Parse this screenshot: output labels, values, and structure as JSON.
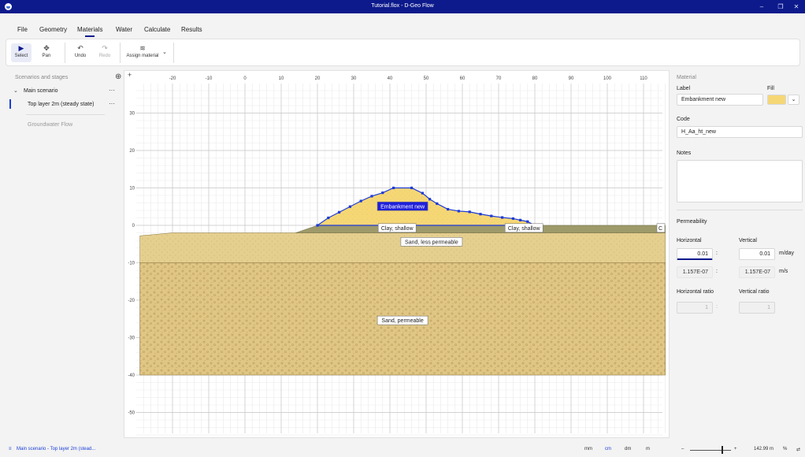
{
  "window": {
    "title": "Tutorial.flox - D-Geo Flow"
  },
  "menu": {
    "items": [
      "File",
      "Geometry",
      "Materials",
      "Water",
      "Calculate",
      "Results"
    ],
    "active": "Materials"
  },
  "toolbar": {
    "select": "Select",
    "pan": "Pan",
    "undo": "Undo",
    "redo": "Redo",
    "assign_material": "Assign material"
  },
  "left_panel": {
    "header": "Scenarios and stages",
    "scenario": "Main scenario",
    "stage": "Top layer 2m (steady state)",
    "section": "Groundwater Flow",
    "more": "···"
  },
  "canvas": {
    "x_ticks": [
      -20,
      -10,
      0,
      10,
      20,
      30,
      40,
      50,
      60,
      70,
      80,
      90,
      100,
      110
    ],
    "y_ticks": [
      30,
      20,
      10,
      0,
      -10,
      -20,
      -30,
      -40,
      -50
    ],
    "layer_labels": {
      "embankment": "Embankment new",
      "clay_left": "Clay, shallow",
      "clay_right": "Clay, shallow",
      "sand_less": "Sand, less permeable",
      "sand_perm": "Sand, permeable",
      "clipped": "C"
    },
    "colors": {
      "embankment": "#f6d776",
      "clay": "#9e9a6a",
      "sand_less": "#e5cf8f",
      "sand_perm": "#e0c684",
      "selection": "#1d3bd6",
      "label_selected_bg": "#1f1fdb"
    }
  },
  "material": {
    "section": "Material",
    "label_caption": "Label",
    "label_value": "Embankment new",
    "fill_caption": "Fill",
    "fill_color": "#f6d776",
    "code_caption": "Code",
    "code_value": "H_Aa_ht_new",
    "notes_caption": "Notes",
    "notes_value": "",
    "permeability_caption": "Permeability",
    "horizontal_caption": "Horizontal",
    "vertical_caption": "Vertical",
    "horizontal_value": "0.01",
    "vertical_value": "0.01",
    "unit_day": "m/day",
    "horizontal_si": "1.157E-07",
    "vertical_si": "1.157E-07",
    "unit_s": "m/s",
    "colon": ":",
    "h_ratio_caption": "Horizontal ratio",
    "v_ratio_caption": "Vertical ratio",
    "h_ratio_value": "1",
    "v_ratio_value": "1"
  },
  "status": {
    "breadcrumb": "Main scenario - Top layer 2m (stead...",
    "units": [
      "mm",
      "cm",
      "dm",
      "m"
    ],
    "active_unit": "cm",
    "zoom_out": "–",
    "zoom_in": "+",
    "zoom_level": "142.99 m",
    "percent": "%"
  }
}
